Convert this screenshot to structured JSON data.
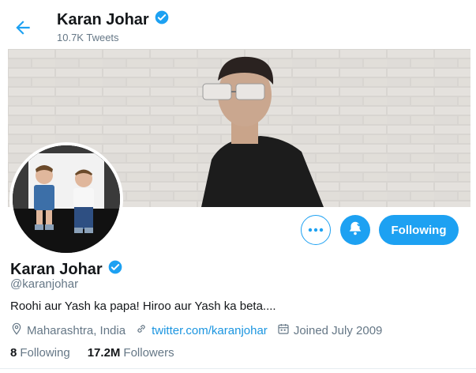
{
  "header": {
    "title": "Karan Johar",
    "tweet_count": "10.7K Tweets"
  },
  "profile": {
    "name": "Karan Johar",
    "handle": "@karanjohar",
    "bio": "Roohi aur Yash ka papa! Hiroo aur Yash ka beta....",
    "location": "Maharashtra, India",
    "website": "twitter.com/karanjohar",
    "joined": "Joined July 2009",
    "following_count": "8",
    "following_label": "Following",
    "followers_count": "17.2M",
    "followers_label": "Followers"
  },
  "actions": {
    "following_button": "Following"
  },
  "colors": {
    "accent": "#1da1f2",
    "secondary_text": "#657786"
  }
}
